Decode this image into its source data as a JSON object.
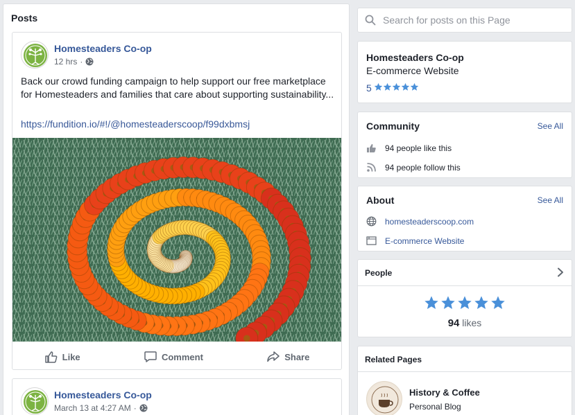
{
  "posts_section": {
    "heading": "Posts",
    "posts": [
      {
        "page_name": "Homesteaders Co-op",
        "time": "12 hrs",
        "separator": "·",
        "text": "Back our crowd funding campaign to help support our free marketplace for Homesteaders and families that care about supporting sustainability...",
        "link": "https://fundition.io/#!/@homesteaderscoop/f99dxbmsj",
        "actions": {
          "like": "Like",
          "comment": "Comment",
          "share": "Share"
        }
      },
      {
        "page_name": "Homesteaders Co-op",
        "time": "March 13 at 4:27 AM",
        "separator": "·"
      }
    ]
  },
  "sidebar": {
    "search": {
      "placeholder": "Search for posts on this Page"
    },
    "info": {
      "name": "Homesteaders Co-op",
      "category": "E-commerce Website",
      "rating": "5",
      "stars": 5
    },
    "community": {
      "title": "Community",
      "see_all": "See All",
      "likes": "94 people like this",
      "follows": "94 people follow this"
    },
    "about": {
      "title": "About",
      "see_all": "See All",
      "website": "homesteaderscoop.com",
      "category": "E-commerce Website"
    },
    "people": {
      "title": "People",
      "stars": 5,
      "likes_count": "94",
      "likes_label": "likes"
    },
    "related": {
      "title": "Related Pages",
      "items": [
        {
          "name": "History & Coffee",
          "category": "Personal Blog"
        }
      ]
    }
  },
  "colors": {
    "link": "#365899",
    "star": "#4a90d9",
    "background": "#e9ebee",
    "avatar_green": "#7cb342"
  },
  "icons": [
    "search-icon",
    "globe-icon",
    "thumbs-up-icon",
    "comment-icon",
    "share-icon",
    "rss-icon",
    "website-icon",
    "category-icon",
    "chevron-right-icon",
    "star-icon"
  ]
}
